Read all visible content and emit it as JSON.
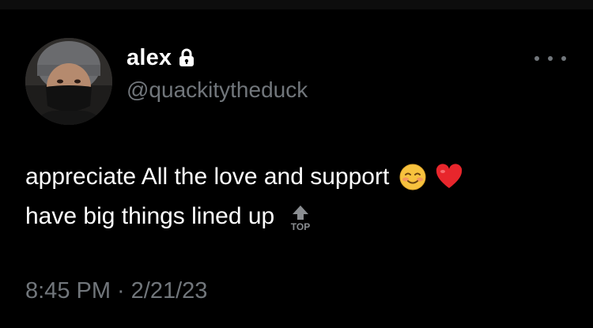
{
  "tweet": {
    "author": {
      "display_name": "alex",
      "handle": "@quackitytheduck",
      "protected_icon": "lock-icon",
      "avatar": "profile-photo"
    },
    "more_icon": "more-horizontal-icon",
    "text_line1": "appreciate All the love and support",
    "text_line2": "have big things lined up",
    "emojis": [
      "smiling-face-emoji",
      "red-heart-emoji",
      "top-arrow-emoji"
    ],
    "top_emoji_label": "TOP",
    "time": "8:45 PM",
    "separator": "·",
    "date": "2/21/23"
  },
  "colors": {
    "background": "#000000",
    "primary_text": "#ffffff",
    "secondary_text": "#71767b"
  }
}
